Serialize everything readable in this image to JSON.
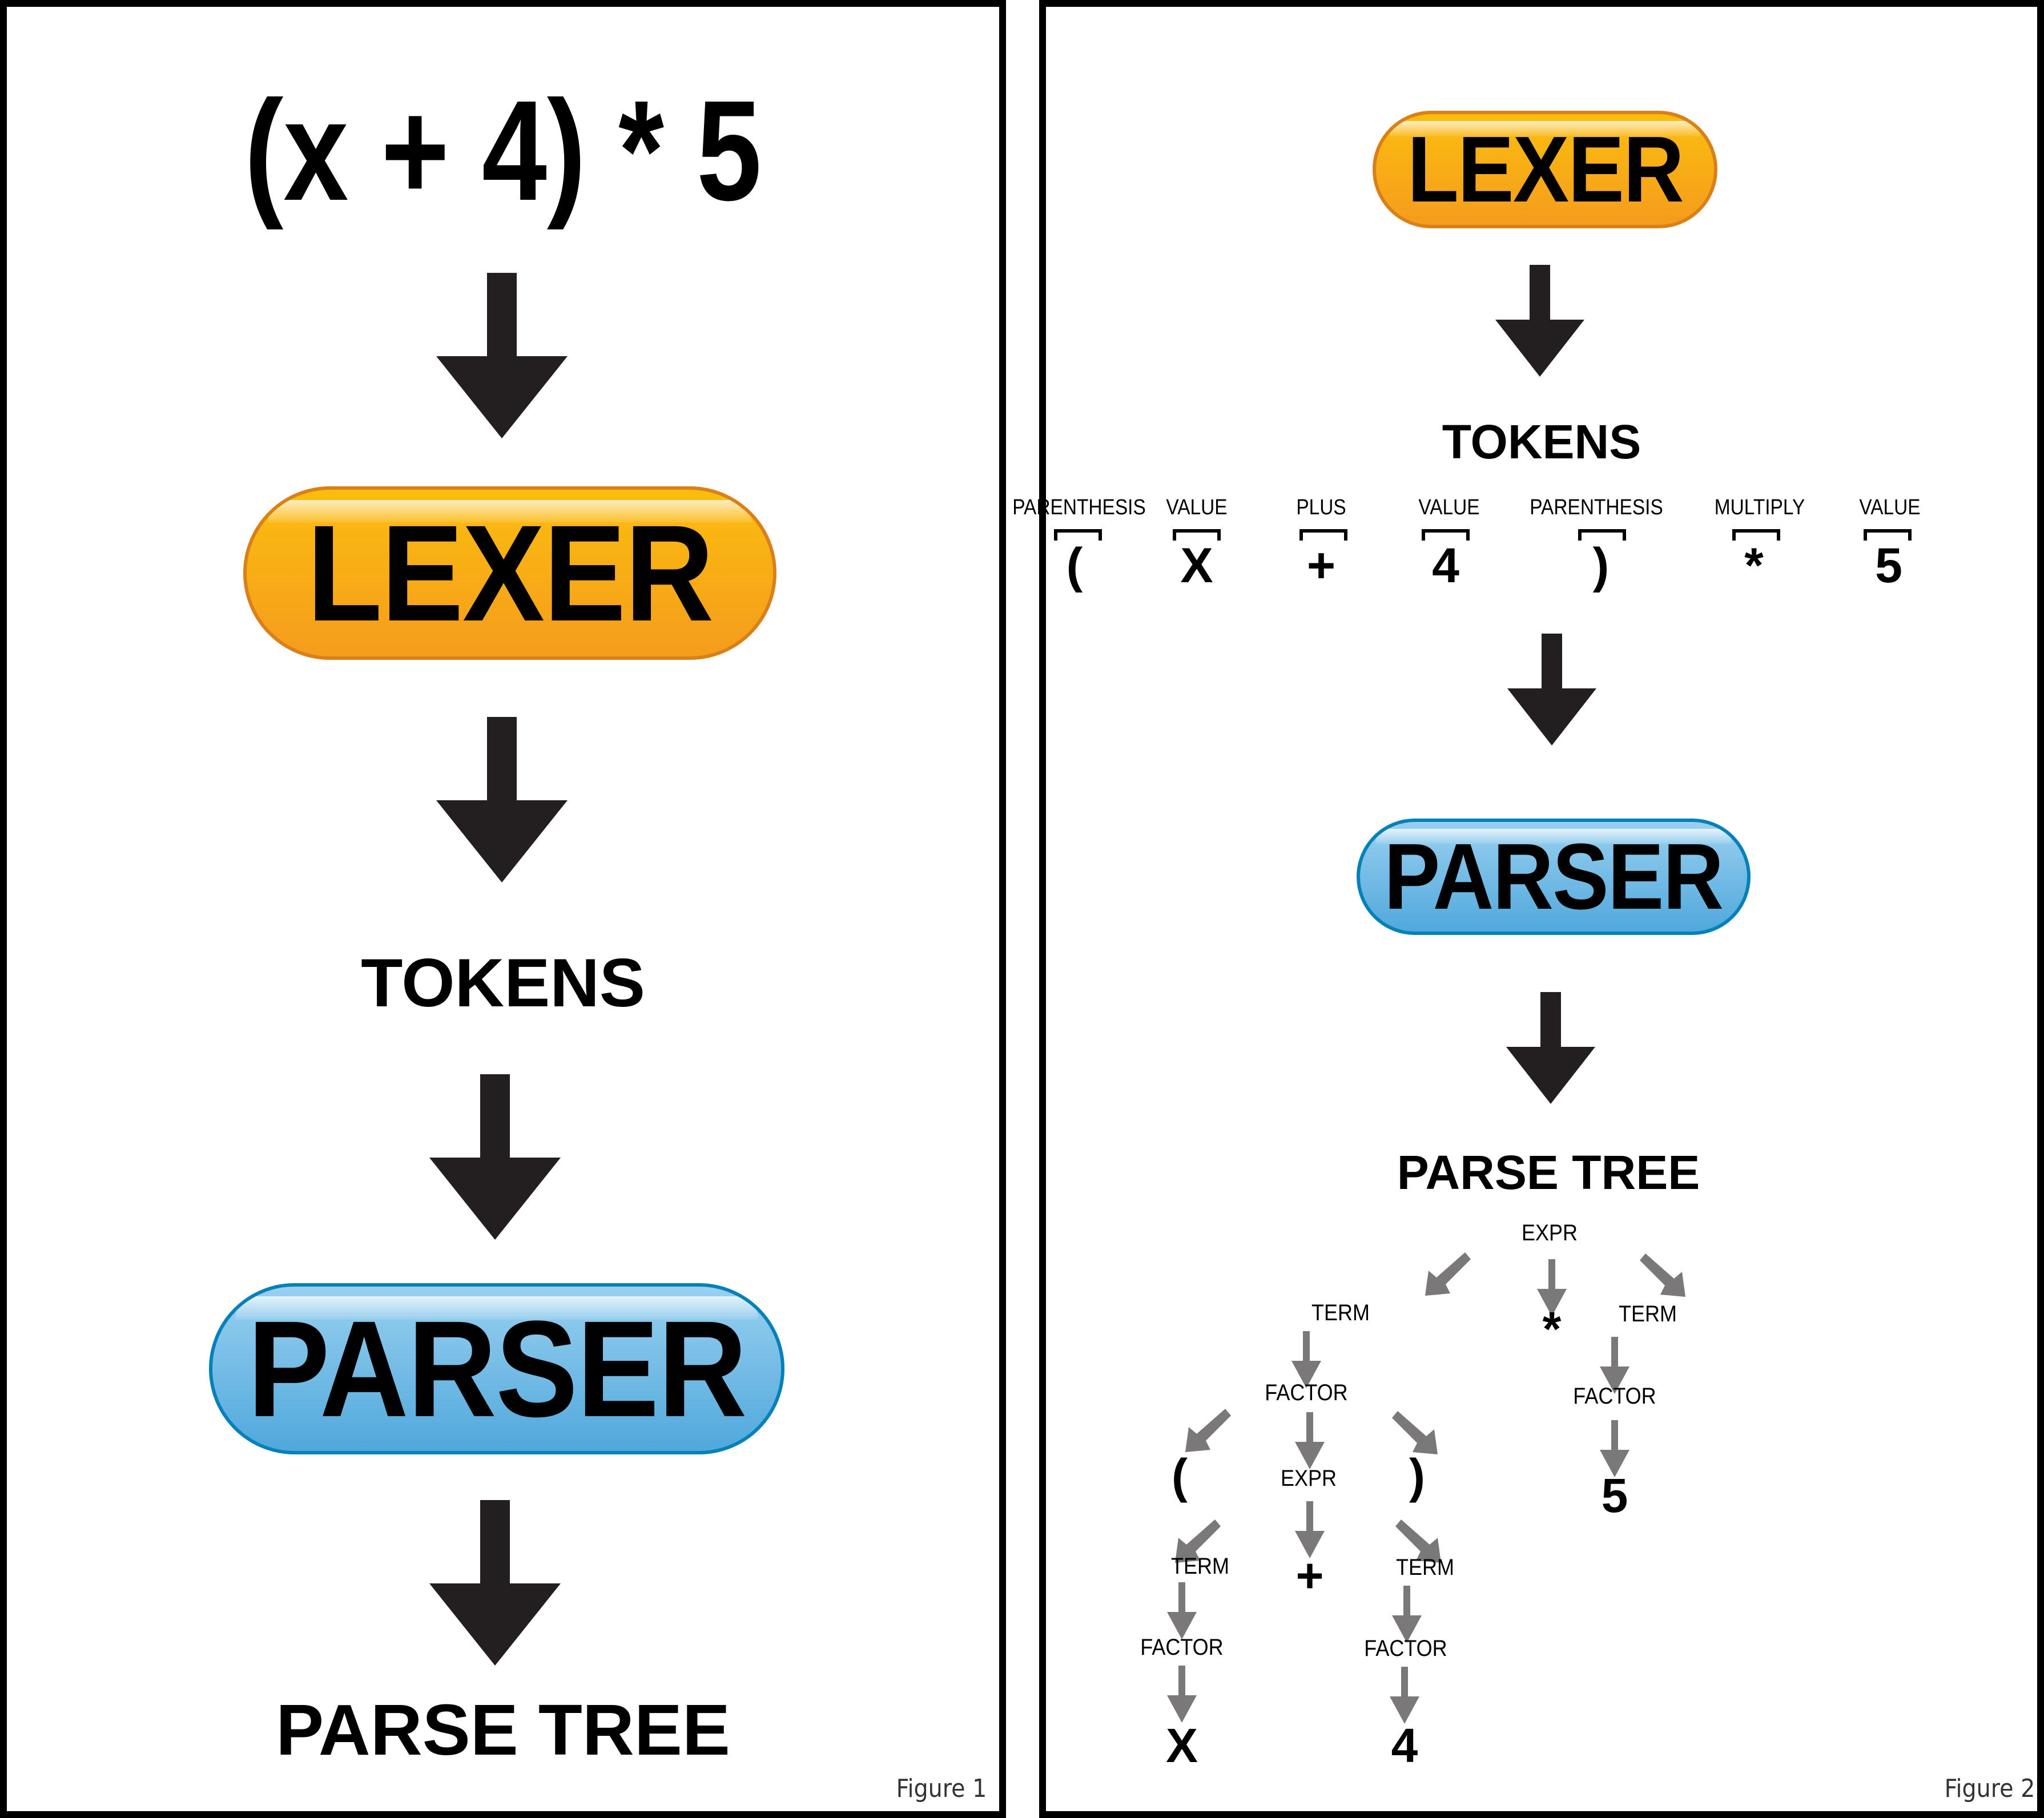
{
  "figure1": {
    "caption": "Figure 1",
    "expression": "(x + 4) * 5",
    "lexer_label": "LEXER",
    "tokens_label": "TOKENS",
    "parser_label": "PARSER",
    "parse_tree_label": "PARSE TREE"
  },
  "figure2": {
    "caption": "Figure 2",
    "lexer_label": "LEXER",
    "tokens_label": "TOKENS",
    "tokens": [
      {
        "type": "PARENTHESIS",
        "value": "("
      },
      {
        "type": "VALUE",
        "value": "X"
      },
      {
        "type": "PLUS",
        "value": "+"
      },
      {
        "type": "VALUE",
        "value": "4"
      },
      {
        "type": "PARENTHESIS",
        "value": ")"
      },
      {
        "type": "MULTIPLY",
        "value": "*"
      },
      {
        "type": "VALUE",
        "value": "5"
      }
    ],
    "parser_label": "PARSER",
    "parse_tree_label": "PARSE TREE",
    "tree": {
      "root": "EXPR",
      "op_mul": "*",
      "left_term": "TERM",
      "left_factor": "FACTOR",
      "lparen": "(",
      "inner_expr": "EXPR",
      "rparen": ")",
      "inner_left_term": "TERM",
      "op_plus": "+",
      "inner_right_term": "TERM",
      "inner_left_factor": "FACTOR",
      "inner_right_factor": "FACTOR",
      "leaf_x": "X",
      "leaf_4": "4",
      "right_term": "TERM",
      "right_factor": "FACTOR",
      "leaf_5": "5"
    }
  },
  "colors": {
    "lexer_top": "#fbbd0e",
    "lexer_bottom": "#f59c1d",
    "lexer_border": "#d98019",
    "parser_top": "#99d0f0",
    "parser_bottom": "#50a8dc",
    "parser_border": "#0580b8",
    "main_arrow": "#231f20",
    "tree_arrow": "#7a7878"
  }
}
